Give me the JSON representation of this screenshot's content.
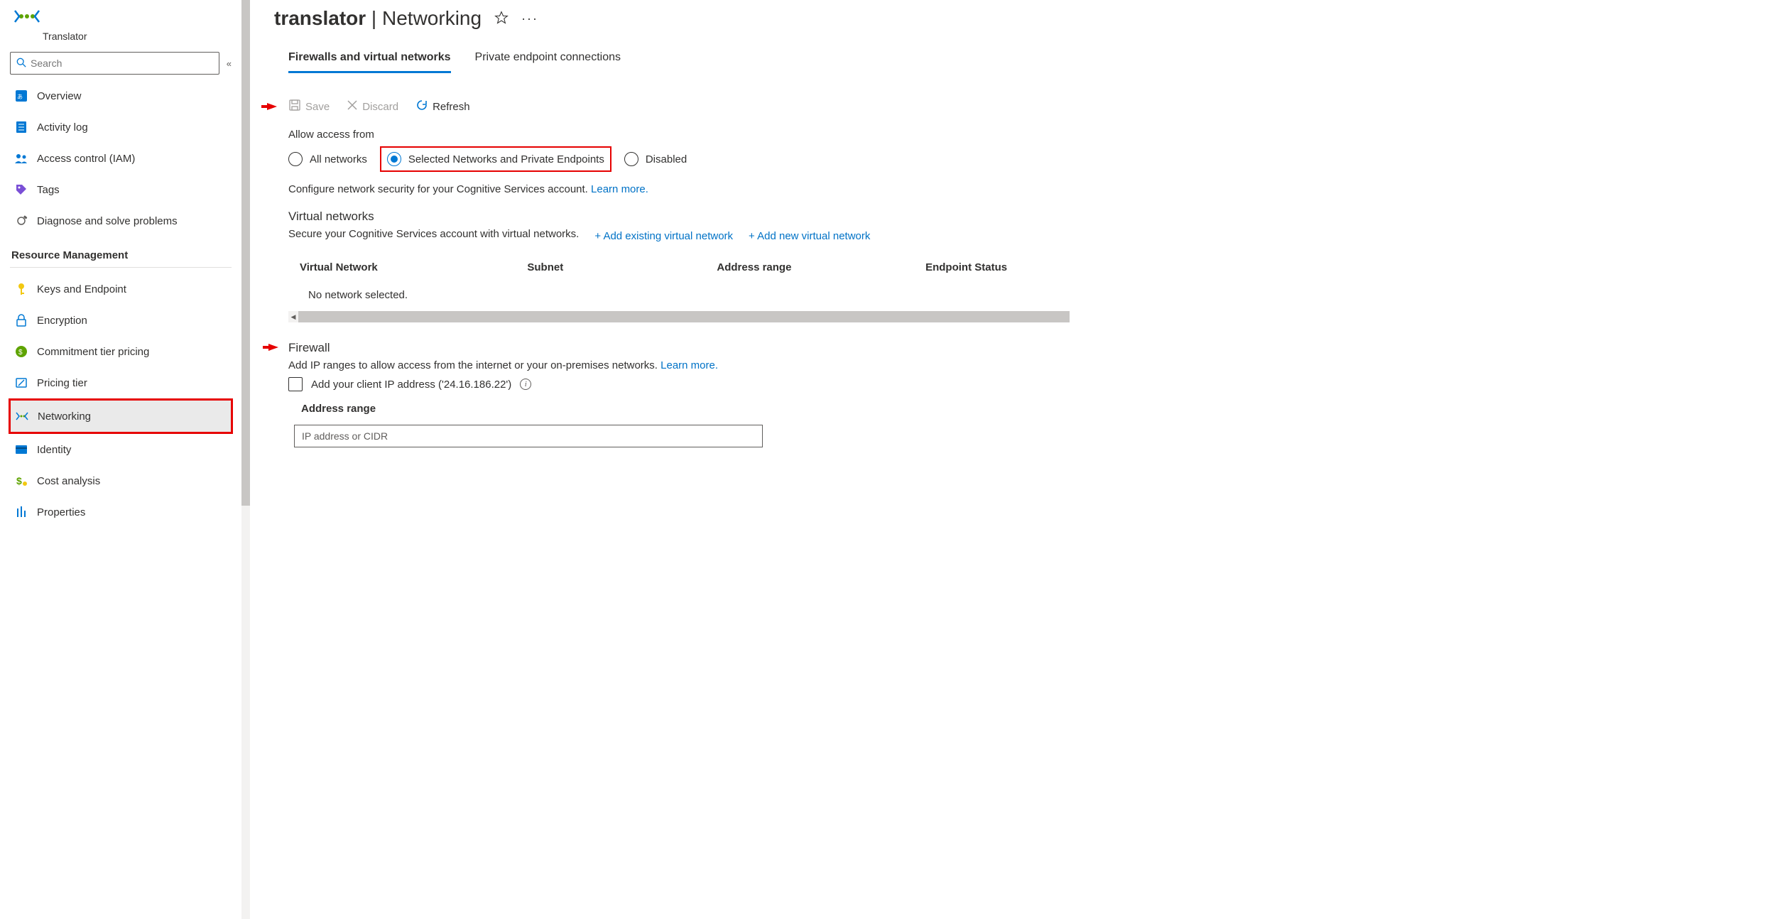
{
  "service_name": "Translator",
  "search_placeholder": "Search",
  "header": {
    "resource": "translator",
    "page": "Networking"
  },
  "sidebar": {
    "main": [
      {
        "label": "Overview"
      },
      {
        "label": "Activity log"
      },
      {
        "label": "Access control (IAM)"
      },
      {
        "label": "Tags"
      },
      {
        "label": "Diagnose and solve problems"
      }
    ],
    "rm_title": "Resource Management",
    "rm": [
      {
        "label": "Keys and Endpoint"
      },
      {
        "label": "Encryption"
      },
      {
        "label": "Commitment tier pricing"
      },
      {
        "label": "Pricing tier"
      },
      {
        "label": "Networking"
      },
      {
        "label": "Identity"
      },
      {
        "label": "Cost analysis"
      },
      {
        "label": "Properties"
      }
    ]
  },
  "tabs": {
    "firewalls": "Firewalls and virtual networks",
    "private": "Private endpoint connections"
  },
  "toolbar": {
    "save": "Save",
    "discard": "Discard",
    "refresh": "Refresh"
  },
  "access": {
    "label": "Allow access from",
    "all": "All networks",
    "selected": "Selected Networks and Private Endpoints",
    "disabled": "Disabled",
    "desc": "Configure network security for your Cognitive Services account. ",
    "learn": "Learn more."
  },
  "vnet": {
    "title": "Virtual networks",
    "desc": "Secure your Cognitive Services account with virtual networks.",
    "add_existing": "+ Add existing virtual network",
    "add_new": "+ Add new virtual network",
    "cols": {
      "vn": "Virtual Network",
      "subnet": "Subnet",
      "range": "Address range",
      "status": "Endpoint Status"
    },
    "empty": "No network selected."
  },
  "firewall": {
    "title": "Firewall",
    "desc": "Add IP ranges to allow access from the internet or your on-premises networks. ",
    "learn": "Learn more.",
    "checkbox_label": "Add your client IP address ('24.16.186.22')",
    "addr_label": "Address range",
    "addr_placeholder": "IP address or CIDR"
  }
}
